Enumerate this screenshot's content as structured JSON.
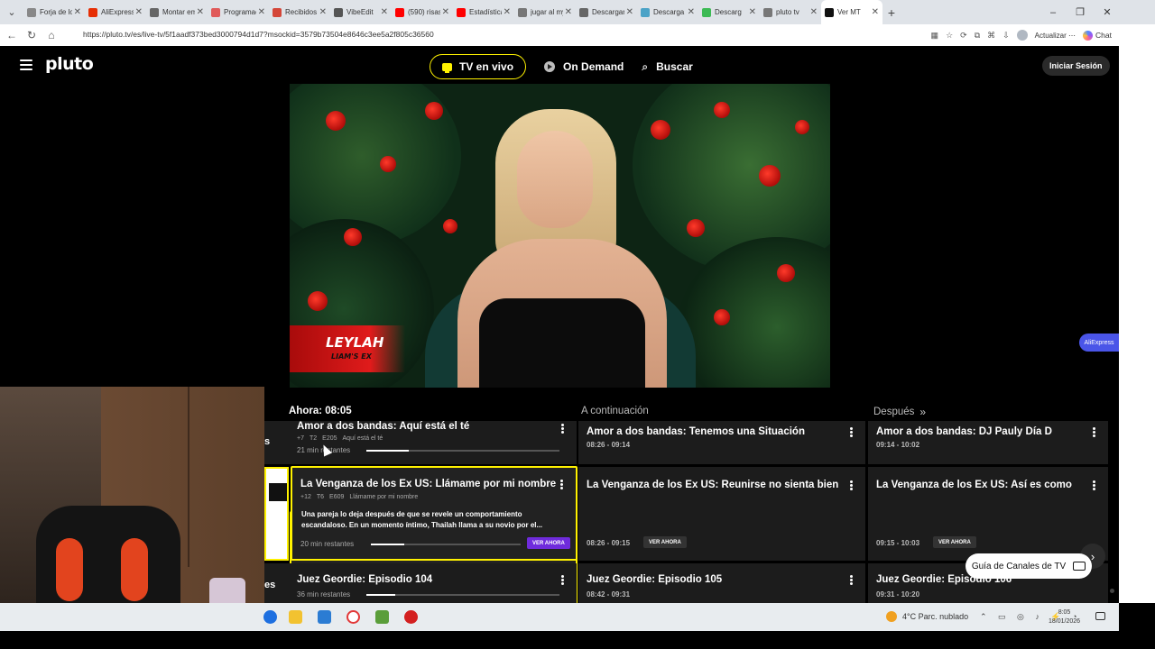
{
  "browser": {
    "tabs": [
      {
        "label": "Forja de los",
        "color": "#888888",
        "active": false
      },
      {
        "label": "AliExpress",
        "color": "#e62e04",
        "active": false
      },
      {
        "label": "Montar em",
        "color": "#666666",
        "active": false
      },
      {
        "label": "Programaci",
        "color": "#e05a5a",
        "active": false
      },
      {
        "label": "Recibidos (",
        "color": "#d44638",
        "active": false
      },
      {
        "label": "VibeEdit",
        "color": "#555555",
        "active": false
      },
      {
        "label": "(590) risas",
        "color": "#ff0000",
        "active": false
      },
      {
        "label": "Estadísticas",
        "color": "#ff0000",
        "active": false
      },
      {
        "label": "jugar al my",
        "color": "#777777",
        "active": false
      },
      {
        "label": "Descargar",
        "color": "#666666",
        "active": false
      },
      {
        "label": "Descarga",
        "color": "#4ba3c7",
        "active": false
      },
      {
        "label": "Descarg",
        "color": "#3cba54",
        "active": false
      },
      {
        "label": "pluto tv",
        "color": "#777777",
        "active": false
      },
      {
        "label": "Ver MT",
        "color": "#111111",
        "active": true
      }
    ],
    "url": "https://pluto.tv/es/live-tv/5f1aadf373bed3000794d1d7?msockid=3579b73504e8646c3ee5a2f805c36560",
    "update_label": "Actualizar",
    "chat_label": "Chat"
  },
  "pluto": {
    "logo": "pluto",
    "nav": {
      "live": "TV en vivo",
      "on_demand": "On Demand",
      "search": "Buscar"
    },
    "signin": "Iniciar Sesión",
    "video": {
      "name_line1": "LEYLAH",
      "name_line2": "LIAM'S EX"
    },
    "ali_badge": "AliExpress",
    "guide": {
      "now_label": "Ahora: 08:05",
      "next_label": "A continuación",
      "after_label": "Después",
      "guide_button": "Guía de Canales de TV",
      "rows": [
        {
          "channel_fragment": "s",
          "now": {
            "title": "Amor a dos bandas: Aquí está el té",
            "rating": "+7",
            "season": "T2",
            "episode": "E205",
            "episode_title": "Aquí está el té",
            "remaining": "21 min restantes",
            "progress": 0.22
          },
          "next": {
            "title": "Amor a dos bandas: Tenemos una Situación",
            "time": "08:26 - 09:14"
          },
          "after": {
            "title": "Amor a dos bandas: DJ Pauly Día D",
            "time": "09:14 - 10:02"
          }
        },
        {
          "channel_fragment": "",
          "now": {
            "title": "La Venganza de los Ex US: Llámame por mi nombre",
            "rating": "+12",
            "season": "T6",
            "episode": "E609",
            "episode_title": "Llámame por mi nombre",
            "description": "Una pareja lo deja después de que se revele un comportamiento escandaloso. En un momento íntimo, Thailah llama a su novio por el...",
            "remaining": "20 min restantes",
            "progress": 0.22,
            "watch": "VER AHORA"
          },
          "next": {
            "title": "La Venganza de los Ex US: Reunirse no sienta bien",
            "time": "08:26 - 09:15",
            "watch": "VER AHORA"
          },
          "after": {
            "title": "La Venganza de los Ex US: Así es como te...",
            "time": "09:15 - 10:03",
            "watch": "VER AHORA"
          }
        },
        {
          "channel_fragment": "es",
          "now": {
            "title": "Juez Geordie: Episodio 104",
            "remaining": "36 min restantes",
            "progress": 0.15
          },
          "next": {
            "title": "Juez Geordie: Episodio 105",
            "time": "08:42 - 09:31"
          },
          "after": {
            "title": "Juez Geordie: Episodio 106",
            "time": "09:31 - 10:20"
          }
        }
      ]
    }
  },
  "taskbar": {
    "weather": "4°C  Parc. nublado",
    "time": "8:05",
    "date": "18/01/2026",
    "weather_badge": "2"
  },
  "colors": {
    "accent": "#fff200",
    "watch_primary": "#6f2bdc",
    "background": "#000000"
  }
}
